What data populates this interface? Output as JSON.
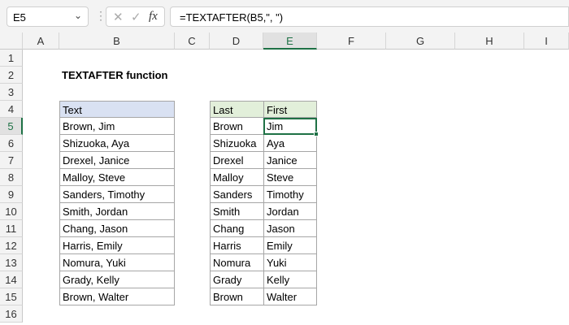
{
  "name_box": "E5",
  "formula": "=TEXTAFTER(B5,\", \")",
  "columns": [
    "A",
    "B",
    "C",
    "D",
    "E",
    "F",
    "G",
    "H",
    "I"
  ],
  "rows": [
    "1",
    "2",
    "3",
    "4",
    "5",
    "6",
    "7",
    "8",
    "9",
    "10",
    "11",
    "12",
    "13",
    "14",
    "15",
    "16"
  ],
  "title": "TEXTAFTER function",
  "source_table": {
    "header": "Text",
    "values": [
      "Brown, Jim",
      "Shizuoka, Aya",
      "Drexel, Janice",
      "Malloy, Steve",
      "Sanders, Timothy",
      "Smith, Jordan",
      "Chang, Jason",
      "Harris, Emily",
      "Nomura, Yuki",
      "Grady, Kelly",
      "Brown, Walter"
    ]
  },
  "result_table": {
    "headers": [
      "Last",
      "First"
    ],
    "last": [
      "Brown",
      "Shizuoka",
      "Drexel",
      "Malloy",
      "Sanders",
      "Smith",
      "Chang",
      "Harris",
      "Nomura",
      "Grady",
      "Brown"
    ],
    "first": [
      "Jim",
      "Aya",
      "Janice",
      "Steve",
      "Timothy",
      "Jordan",
      "Jason",
      "Emily",
      "Yuki",
      "Kelly",
      "Walter"
    ]
  },
  "colors": {
    "source_header": "#d9e1f2",
    "result_header": "#e2efda",
    "accent": "#1e7145"
  }
}
